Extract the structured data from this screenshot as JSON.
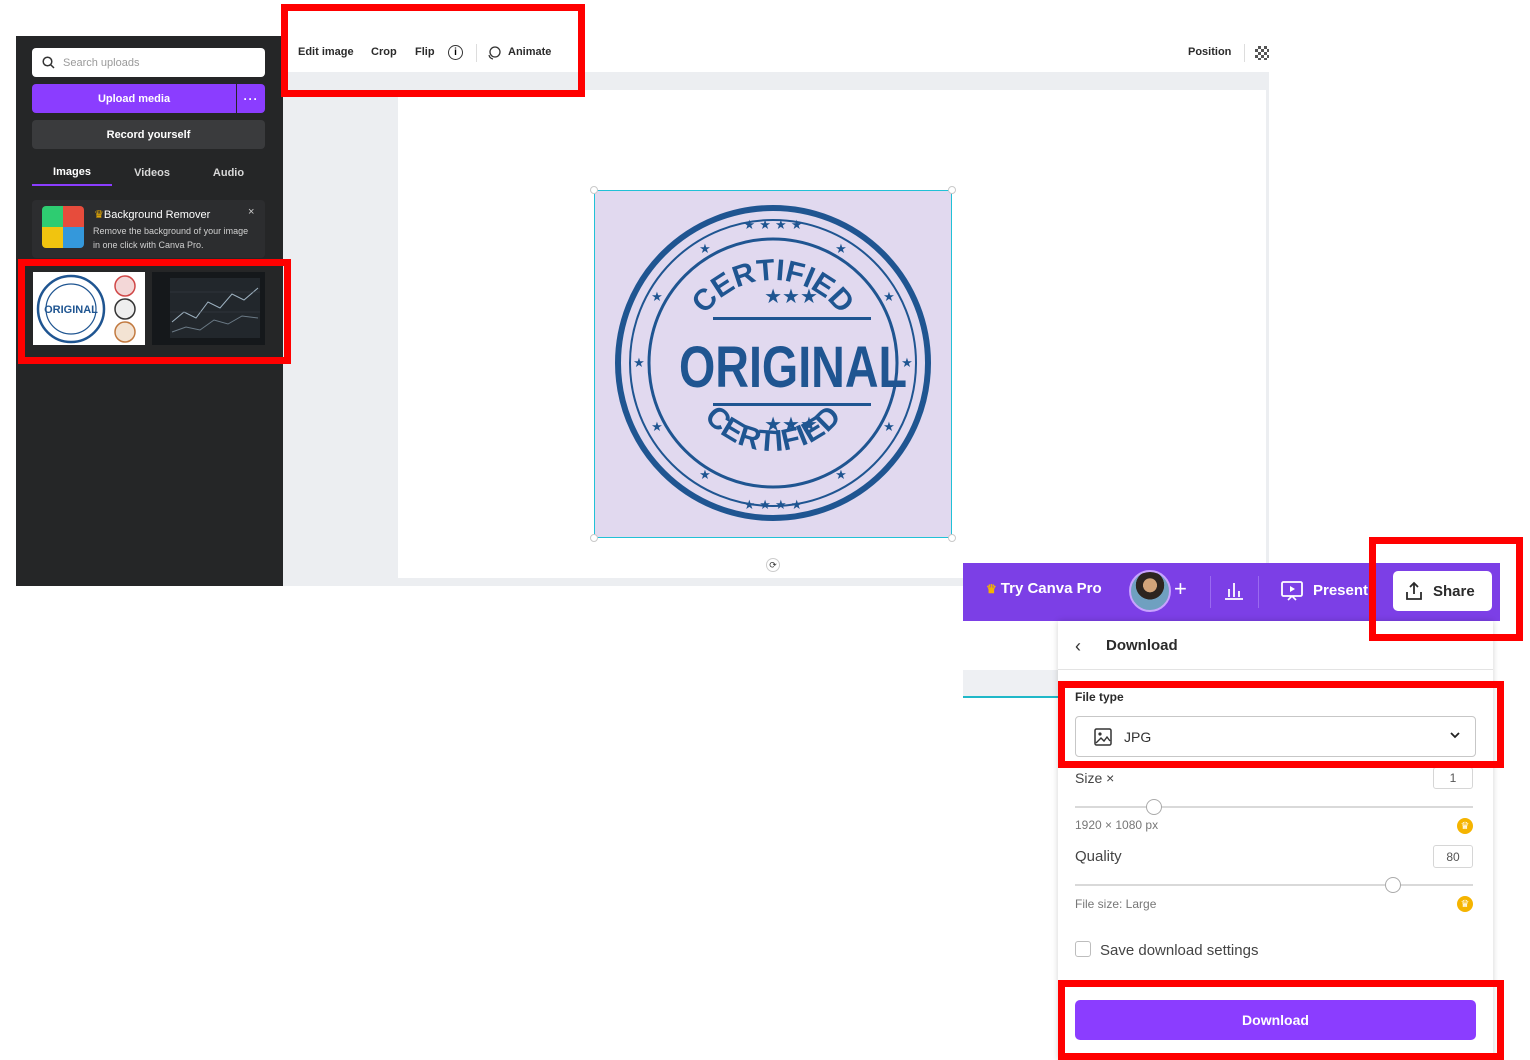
{
  "uploads_panel": {
    "search_placeholder": "Search uploads",
    "upload_button": "Upload media",
    "upload_more": "···",
    "record_button": "Record yourself",
    "tabs": [
      {
        "label": "Images",
        "active": true
      },
      {
        "label": "Videos",
        "active": false
      },
      {
        "label": "Audio",
        "active": false
      }
    ],
    "promo": {
      "crown": "♛",
      "title": "Background Remover",
      "description": "Remove the background of your image in one click with Canva Pro.",
      "close": "×"
    },
    "thumbnails": [
      {
        "name": "original-stamp-collage",
        "text": "ORIGINAL"
      },
      {
        "name": "stock-chart-screens"
      }
    ],
    "collapse_icon": "‹"
  },
  "toolbar": {
    "edit_image": "Edit image",
    "crop": "Crop",
    "flip": "Flip",
    "info_icon": "i",
    "animate": "Animate",
    "position": "Position"
  },
  "canvas": {
    "image": {
      "top_text": "CERTIFIED",
      "main_text": "ORIGINAL",
      "bottom_text": "CERTIFIED",
      "color": "#1f5591",
      "background": "#e1d9ef"
    },
    "rotate_icon": "⟳"
  },
  "top_bar": {
    "try_pro": "Try Canva Pro",
    "crown": "♛",
    "add": "+",
    "present": "Present",
    "share": "Share",
    "color": "#7c3fe6"
  },
  "download_panel": {
    "back": "‹",
    "title": "Download",
    "file_type_label": "File type",
    "file_type_value": "JPG",
    "size_label": "Size ×",
    "size_value": "1",
    "size_dimensions": "1920 × 1080 px",
    "quality_label": "Quality",
    "quality_value": "80",
    "file_size": "File size: Large",
    "save_settings": "Save download settings",
    "download_button": "Download",
    "accent": "#8b3dff"
  }
}
